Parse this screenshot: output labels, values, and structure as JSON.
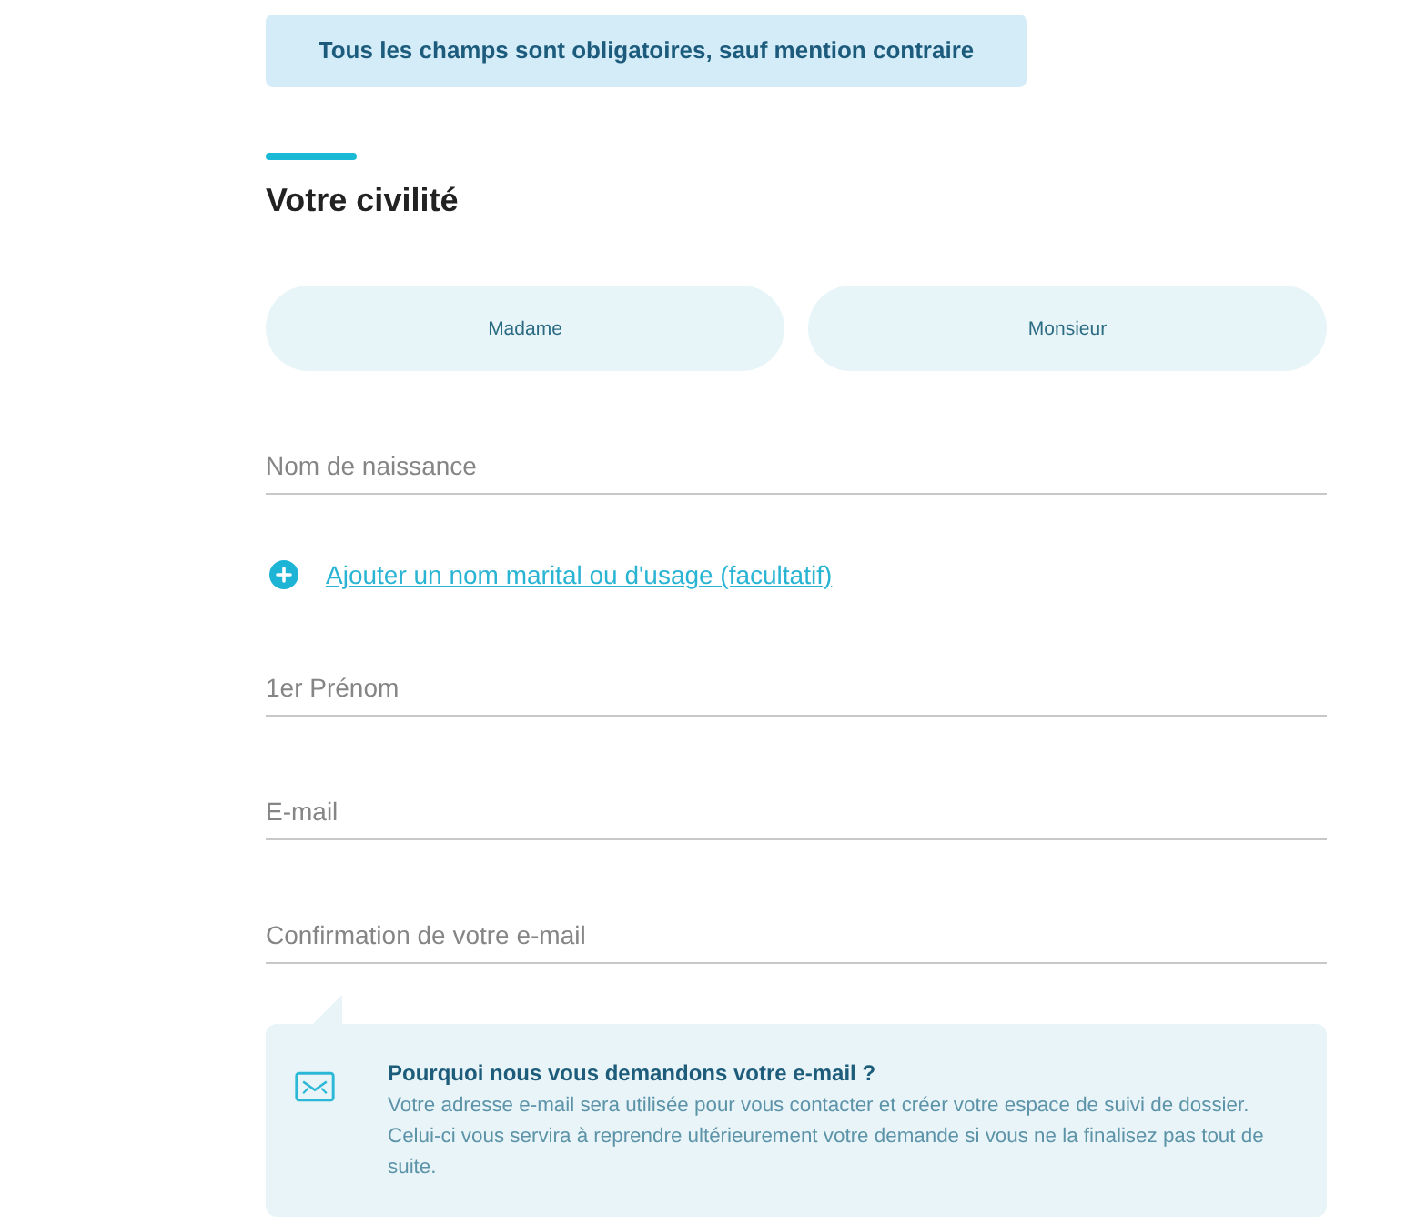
{
  "notice": {
    "text": "Tous les champs sont obligatoires, sauf mention contraire"
  },
  "section": {
    "title": "Votre civilité"
  },
  "civility_options": [
    {
      "label": "Madame",
      "selected": false
    },
    {
      "label": "Monsieur",
      "selected": false
    }
  ],
  "form_items": [
    {
      "kind": "text_field",
      "placeholder": "Nom de naissance"
    },
    {
      "kind": "add_link",
      "label": "Ajouter un nom marital ou d'usage (facultatif)"
    },
    {
      "kind": "text_field",
      "placeholder": "1er Prénom"
    },
    {
      "kind": "text_field",
      "placeholder": "E-mail"
    },
    {
      "kind": "text_field",
      "placeholder": "Confirmation de votre e-mail"
    }
  ],
  "info": {
    "title": "Pourquoi nous vous demandons votre e-mail ?",
    "text": "Votre adresse e-mail sera utilisée pour vous contacter et créer votre espace de suivi de dossier. Celui-ci vous servira à reprendre ultérieurement votre demande si vous ne la finalisez pas tout de suite."
  }
}
